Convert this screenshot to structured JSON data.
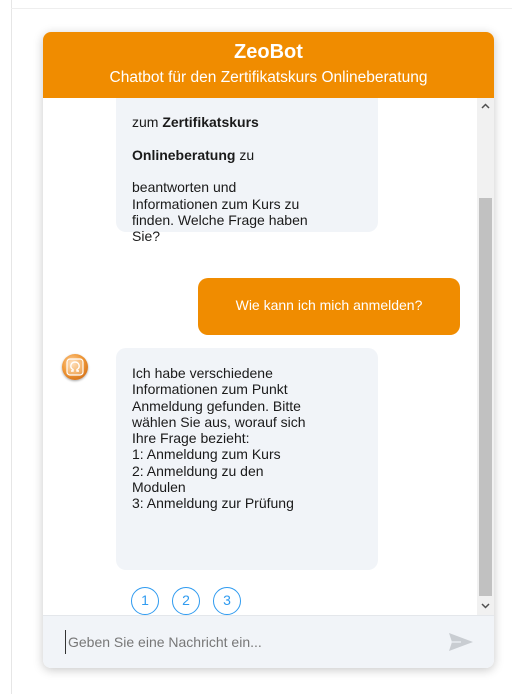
{
  "header": {
    "title": "ZeoBot",
    "subtitle": "Chatbot für den Zertifikatskurs Onlineberatung"
  },
  "messages": {
    "bot_intro": {
      "line_cut": "zum ",
      "bold_1": "Zertifikatskurs",
      "bold_2": "Onlineberatung",
      "after_bold": " zu",
      "rest": "beantworten und\nInformationen zum Kurs zu\nfinden. Welche Frage haben\nSie?"
    },
    "user_question": "Wie kann ich mich anmelden?",
    "bot_reply": "Ich habe verschiedene\nInformationen zum Punkt\nAnmeldung gefunden. Bitte\nwählen Sie aus, worauf sich\nIhre Frage bezieht:\n1: Anmeldung zum Kurs\n2: Anmeldung zu den\nModulen\n3: Anmeldung zur Prüfung",
    "options": [
      "1",
      "2",
      "3"
    ]
  },
  "input": {
    "placeholder": "Geben Sie eine Nachricht ein..."
  },
  "icons": {
    "avatar": "omega-logo-icon",
    "send": "send-arrow-icon",
    "scroll_up": "chevron-up-icon",
    "scroll_down": "chevron-down-icon"
  },
  "colors": {
    "brand": "#f08c00",
    "bot_bubble": "#f1f4f8",
    "option_accent": "#2f9bf0"
  }
}
